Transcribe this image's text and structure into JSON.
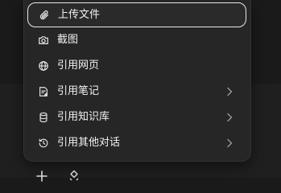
{
  "menu": {
    "items": [
      {
        "label": "上传文件",
        "icon": "paperclip-icon",
        "has_submenu": false,
        "active": true
      },
      {
        "label": "截图",
        "icon": "camera-icon",
        "has_submenu": false,
        "active": false
      },
      {
        "label": "引用网页",
        "icon": "globe-icon",
        "has_submenu": false,
        "active": false
      },
      {
        "label": "引用笔记",
        "icon": "note-icon",
        "has_submenu": true,
        "active": false
      },
      {
        "label": "引用知识库",
        "icon": "database-icon",
        "has_submenu": true,
        "active": false
      },
      {
        "label": "引用其他对话",
        "icon": "history-icon",
        "has_submenu": true,
        "active": false
      }
    ]
  },
  "toolbar": {
    "icons": [
      "plus-icon",
      "tools-icon"
    ]
  },
  "colors": {
    "background": "#1a1a1a",
    "menu_background": "#262626",
    "text": "#f2f2f2",
    "active_border": "#e8e8e8",
    "chevron": "#9a9a9a"
  }
}
